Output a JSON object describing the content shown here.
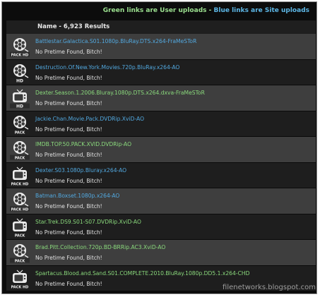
{
  "banner": {
    "green_text": "Green links are User uploads - ",
    "blue_text": "Blue links are Site uploads"
  },
  "header": {
    "results_label": "Name - 6,923 Results"
  },
  "rows": [
    {
      "title": "Battlestar.Galactica.S01.1080p.BluRay.DTS.x264-FraMeSToR",
      "link_color": "blue",
      "icon": "pack-hd-film-reel-icon",
      "icon_text": "PACK HD",
      "pretime": "No Pretime Found, Bitch!"
    },
    {
      "title": "Destruction.Of.New.York.Movies.720p.BluRay.x264-AO",
      "link_color": "blue",
      "icon": "hd-film-reel-icon",
      "icon_text": "HD",
      "pretime": "No Pretime Found, Bitch!"
    },
    {
      "title": "Dexter.Season.1.2006.Bluray.1080p.DTS.x264.dxva-FraMeSToR",
      "link_color": "green",
      "icon": "hd-tv-icon",
      "icon_text": "HD",
      "pretime": "No Pretime Found, Bitch!"
    },
    {
      "title": "Jackie.Chan.Movie.Pack.DVDRip.XviD-AO",
      "link_color": "blue",
      "icon": "pack-film-reel-icon",
      "icon_text": "PACK",
      "pretime": "No Pretime Found, Bitch!"
    },
    {
      "title": "IMDB.TOP.50.PACK.XVID.DVDRip-AO",
      "link_color": "green",
      "icon": "pack-film-reel-icon",
      "icon_text": "PACK",
      "pretime": "No Pretime Found, Bitch!"
    },
    {
      "title": "Dexter.S03.1080p.Bluray.x264-AO",
      "link_color": "blue",
      "icon": "pack-hd-tv-icon",
      "icon_text": "PACK HD",
      "pretime": "No Pretime Found, Bitch!"
    },
    {
      "title": "Batman.Boxset.1080p.x264-AO",
      "link_color": "blue",
      "icon": "pack-hd-film-reel-icon",
      "icon_text": "PACK HD",
      "pretime": "No Pretime Found, Bitch!"
    },
    {
      "title": "Star.Trek.DS9.S01-S07.DVDRip.XviD-AO",
      "link_color": "green",
      "icon": "pack-tv-icon",
      "icon_text": "PACK",
      "pretime": "No Pretime Found, Bitch!"
    },
    {
      "title": "Brad.Pitt.Collection.720p.BD-BRRip.AC3.XviD-AO",
      "link_color": "green",
      "icon": "pack-film-reel-icon",
      "icon_text": "PACK",
      "pretime": "No Pretime Found, Bitch!"
    },
    {
      "title": "Spartacus.Blood.and.Sand.S01.COMPLETE.2010.BluRay.1080p.DD5.1.x264-CHD",
      "link_color": "green",
      "icon": "pack-hd-tv-icon",
      "icon_text": "PACK HD",
      "pretime": "No Pretime Found, Bitch!"
    }
  ],
  "watermark": "filenetworks.blogspot.com",
  "colors": {
    "green_link": "#8ad97c",
    "blue_link": "#52a9e0",
    "odd_row": "#3e3e3e",
    "even_row": "#1e1e1e"
  }
}
